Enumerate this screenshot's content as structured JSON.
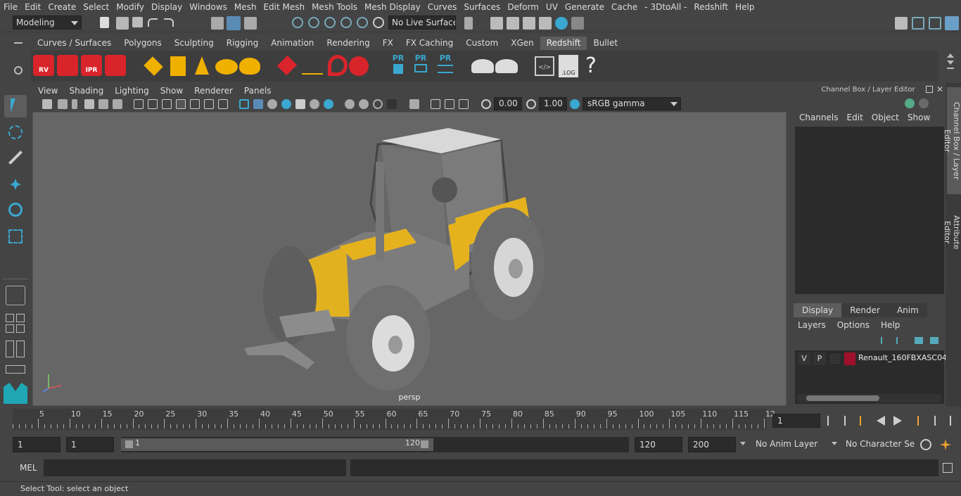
{
  "menubar": [
    "File",
    "Edit",
    "Create",
    "Select",
    "Modify",
    "Display",
    "Windows",
    "Mesh",
    "Edit Mesh",
    "Mesh Tools",
    "Mesh Display",
    "Curves",
    "Surfaces",
    "Deform",
    "UV",
    "Generate",
    "Cache",
    "- 3DtoAll -",
    "Redshift",
    "Help"
  ],
  "status": {
    "mode": "Modeling",
    "live_surface": "No Live Surface"
  },
  "shelf_tabs": [
    "Curves / Surfaces",
    "Polygons",
    "Sculpting",
    "Rigging",
    "Animation",
    "Rendering",
    "FX",
    "FX Caching",
    "Custom",
    "XGen",
    "Redshift",
    "Bullet"
  ],
  "shelf_active": "Redshift",
  "shelf_icons": {
    "rv": "RV",
    "ipr": "IPR",
    "pr": "PR",
    "log": ".LOG",
    "help": "?"
  },
  "viewport_menu": [
    "View",
    "Shading",
    "Lighting",
    "Show",
    "Renderer",
    "Panels"
  ],
  "viewport_tools": {
    "exposure": "0.00",
    "gamma": "1.00",
    "colorspace": "sRGB gamma"
  },
  "viewport_label": "persp",
  "channel_box": {
    "title": "Channel Box / Layer Editor",
    "menu": [
      "Channels",
      "Edit",
      "Object",
      "Show"
    ]
  },
  "layer_tabs": [
    "Display",
    "Render",
    "Anim"
  ],
  "layer_tab_active": "Display",
  "layer_menu": [
    "Layers",
    "Options",
    "Help"
  ],
  "layer_row": {
    "v": "V",
    "p": "P",
    "name": "Renault_160FBXASC04",
    "color": "#a0102a"
  },
  "side_tabs": [
    "Channel Box / Layer Editor",
    "Attribute Editor"
  ],
  "timeline": {
    "ticks": [
      "5",
      "10",
      "15",
      "20",
      "25",
      "30",
      "35",
      "40",
      "45",
      "50",
      "55",
      "60",
      "65",
      "70",
      "75",
      "80",
      "85",
      "90",
      "95",
      "100",
      "105",
      "110",
      "115",
      "12"
    ],
    "start_marker": "1",
    "current_frame": "1"
  },
  "range": {
    "start": "1",
    "start2": "1",
    "slider_start": "1",
    "slider_end": "120",
    "end": "120",
    "end2": "200",
    "anim_layer": "No Anim Layer",
    "char_set": "No Character Set"
  },
  "cmd": {
    "label": "MEL"
  },
  "help_line": "Select Tool: select an object"
}
